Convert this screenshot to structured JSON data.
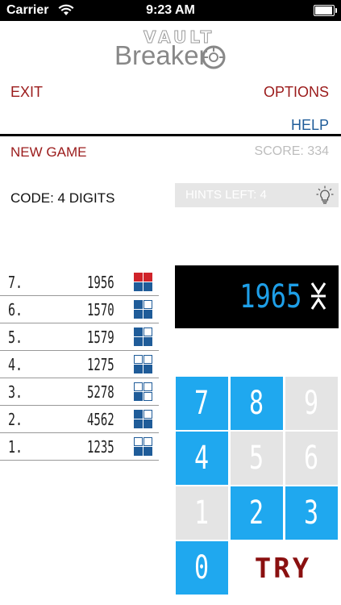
{
  "status_bar": {
    "carrier": "Carrier",
    "time": "9:23 AM",
    "battery_level": 0.95
  },
  "logo": {
    "top_text": "VAULT",
    "main_text": "Breaker"
  },
  "nav": {
    "exit": "EXIT",
    "options": "OPTIONS",
    "help": "HELP"
  },
  "game": {
    "new_game": "NEW GAME",
    "score": "SCORE: 334",
    "code_label": "CODE: 4 DIGITS",
    "hints_left": "HINTS LEFT: 4"
  },
  "guesses": [
    {
      "num": "7.",
      "value": "1956",
      "marks": [
        "red",
        "red",
        "blue",
        "blue"
      ]
    },
    {
      "num": "6.",
      "value": "1570",
      "marks": [
        "blue",
        "empty",
        "blue",
        "blue"
      ]
    },
    {
      "num": "5.",
      "value": "1579",
      "marks": [
        "blue",
        "empty",
        "blue",
        "blue"
      ]
    },
    {
      "num": "4.",
      "value": "1275",
      "marks": [
        "empty",
        "empty",
        "blue",
        "blue"
      ]
    },
    {
      "num": "3.",
      "value": "5278",
      "marks": [
        "empty",
        "empty",
        "blue",
        "empty"
      ]
    },
    {
      "num": "2.",
      "value": "4562",
      "marks": [
        "blue",
        "empty",
        "blue",
        "blue"
      ]
    },
    {
      "num": "1.",
      "value": "1235",
      "marks": [
        "empty",
        "empty",
        "blue",
        "blue"
      ]
    }
  ],
  "display": {
    "entry": "1965"
  },
  "keypad": [
    {
      "label": "7",
      "active": true
    },
    {
      "label": "8",
      "active": true
    },
    {
      "label": "9",
      "active": false
    },
    {
      "label": "4",
      "active": true
    },
    {
      "label": "5",
      "active": false
    },
    {
      "label": "6",
      "active": false
    },
    {
      "label": "1",
      "active": false
    },
    {
      "label": "2",
      "active": true
    },
    {
      "label": "3",
      "active": true
    },
    {
      "label": "0",
      "active": true
    }
  ],
  "try_label": "TRY",
  "colors": {
    "accent_blue": "#1fa8ef",
    "mark_blue": "#1f5c99",
    "mark_red": "#d0232a",
    "link_red": "#9b1b1b"
  }
}
